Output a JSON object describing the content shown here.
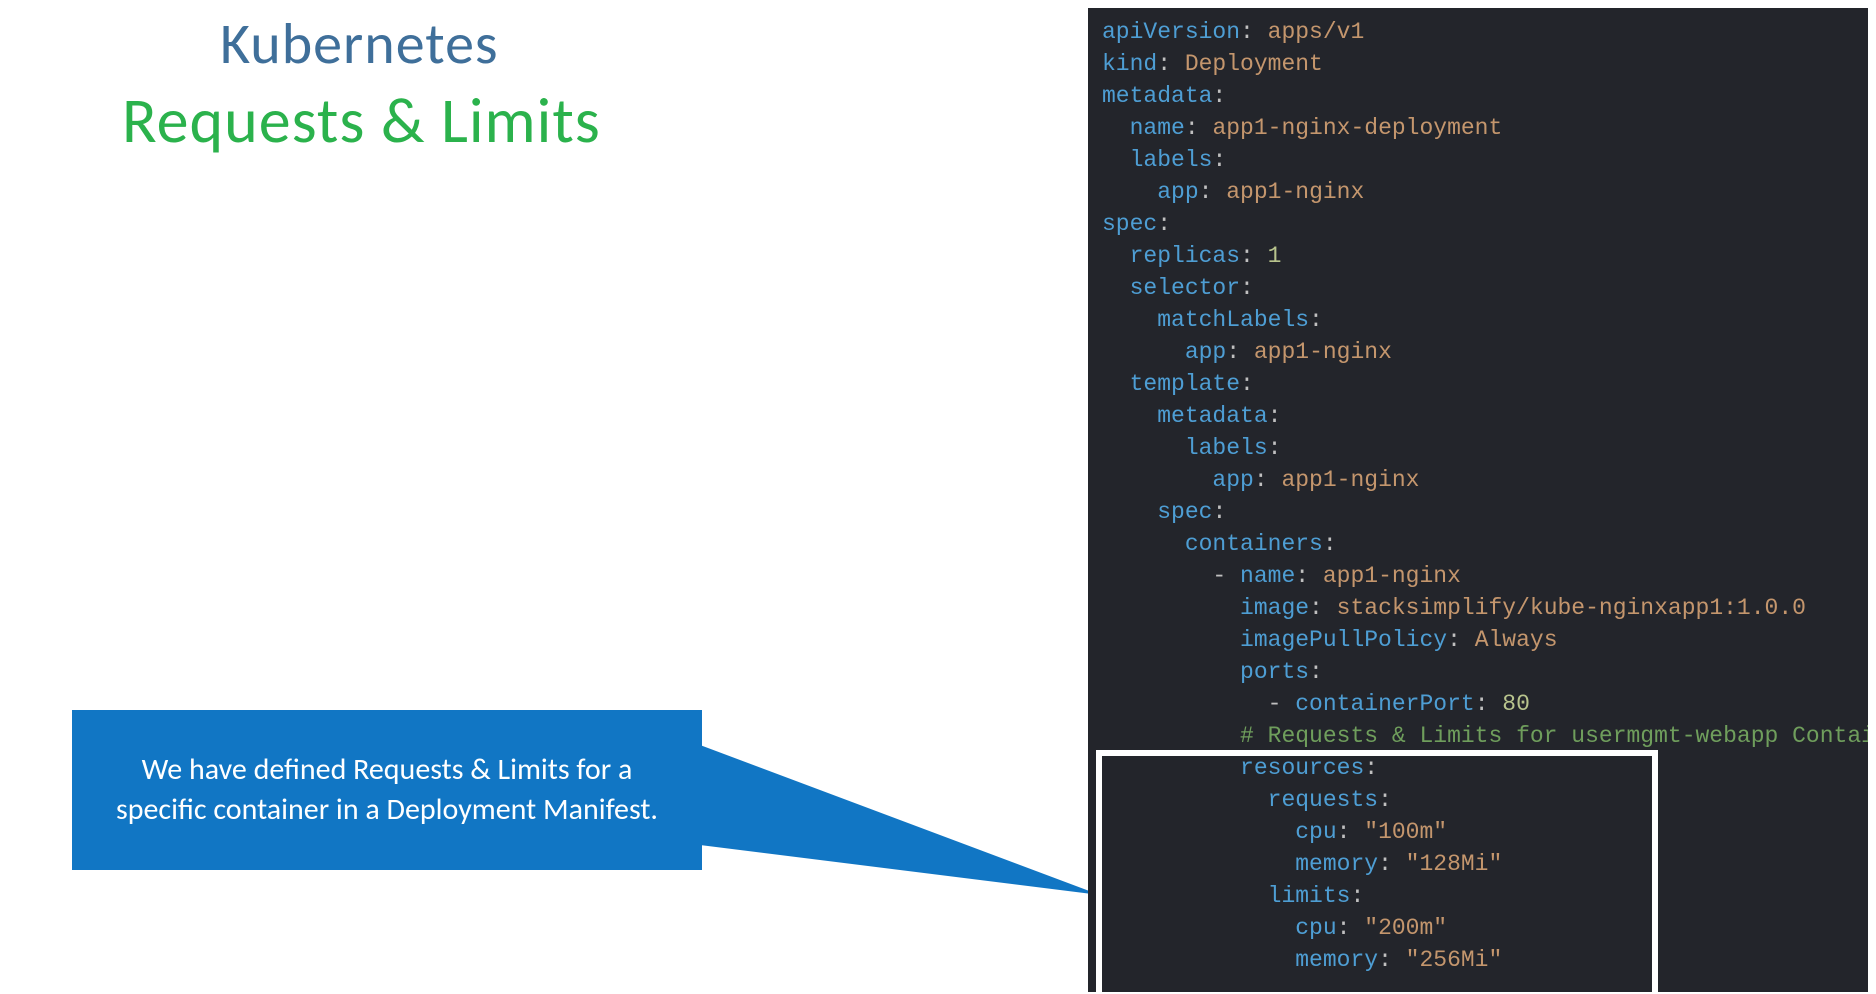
{
  "titles": {
    "line1": "Kubernetes",
    "line2": "Requests & Limits"
  },
  "callout": {
    "text": "We have defined  Requests & Limits for a specific container in a Deployment Manifest."
  },
  "highlight": {
    "purpose": "resources-block-highlight"
  },
  "yaml": {
    "apiVersion_key": "apiVersion",
    "apiVersion_val": "apps/v1",
    "kind_key": "kind",
    "kind_val": "Deployment",
    "metadata_key": "metadata",
    "name_key": "name",
    "name_val": "app1-nginx-deployment",
    "labels_key": "labels",
    "app_key": "app",
    "app_val": "app1-nginx",
    "spec_key": "spec",
    "replicas_key": "replicas",
    "replicas_val": "1",
    "selector_key": "selector",
    "matchLabels_key": "matchLabels",
    "template_key": "template",
    "containers_key": "containers",
    "c_name_key": "name",
    "c_name_val": "app1-nginx",
    "image_key": "image",
    "image_val": "stacksimplify/kube-nginxapp1:1.0.0",
    "imagePullPolicy_key": "imagePullPolicy",
    "imagePullPolicy_val": "Always",
    "ports_key": "ports",
    "containerPort_key": "containerPort",
    "containerPort_val": "80",
    "comment": "# Requests & Limits for usermgmt-webapp Container",
    "resources_key": "resources",
    "requests_key": "requests",
    "cpu_key": "cpu",
    "req_cpu_val": "\"100m\"",
    "memory_key": "memory",
    "req_mem_val": "\"128Mi\"",
    "limits_key": "limits",
    "lim_cpu_val": "\"200m\"",
    "lim_mem_val": "\"256Mi\""
  }
}
